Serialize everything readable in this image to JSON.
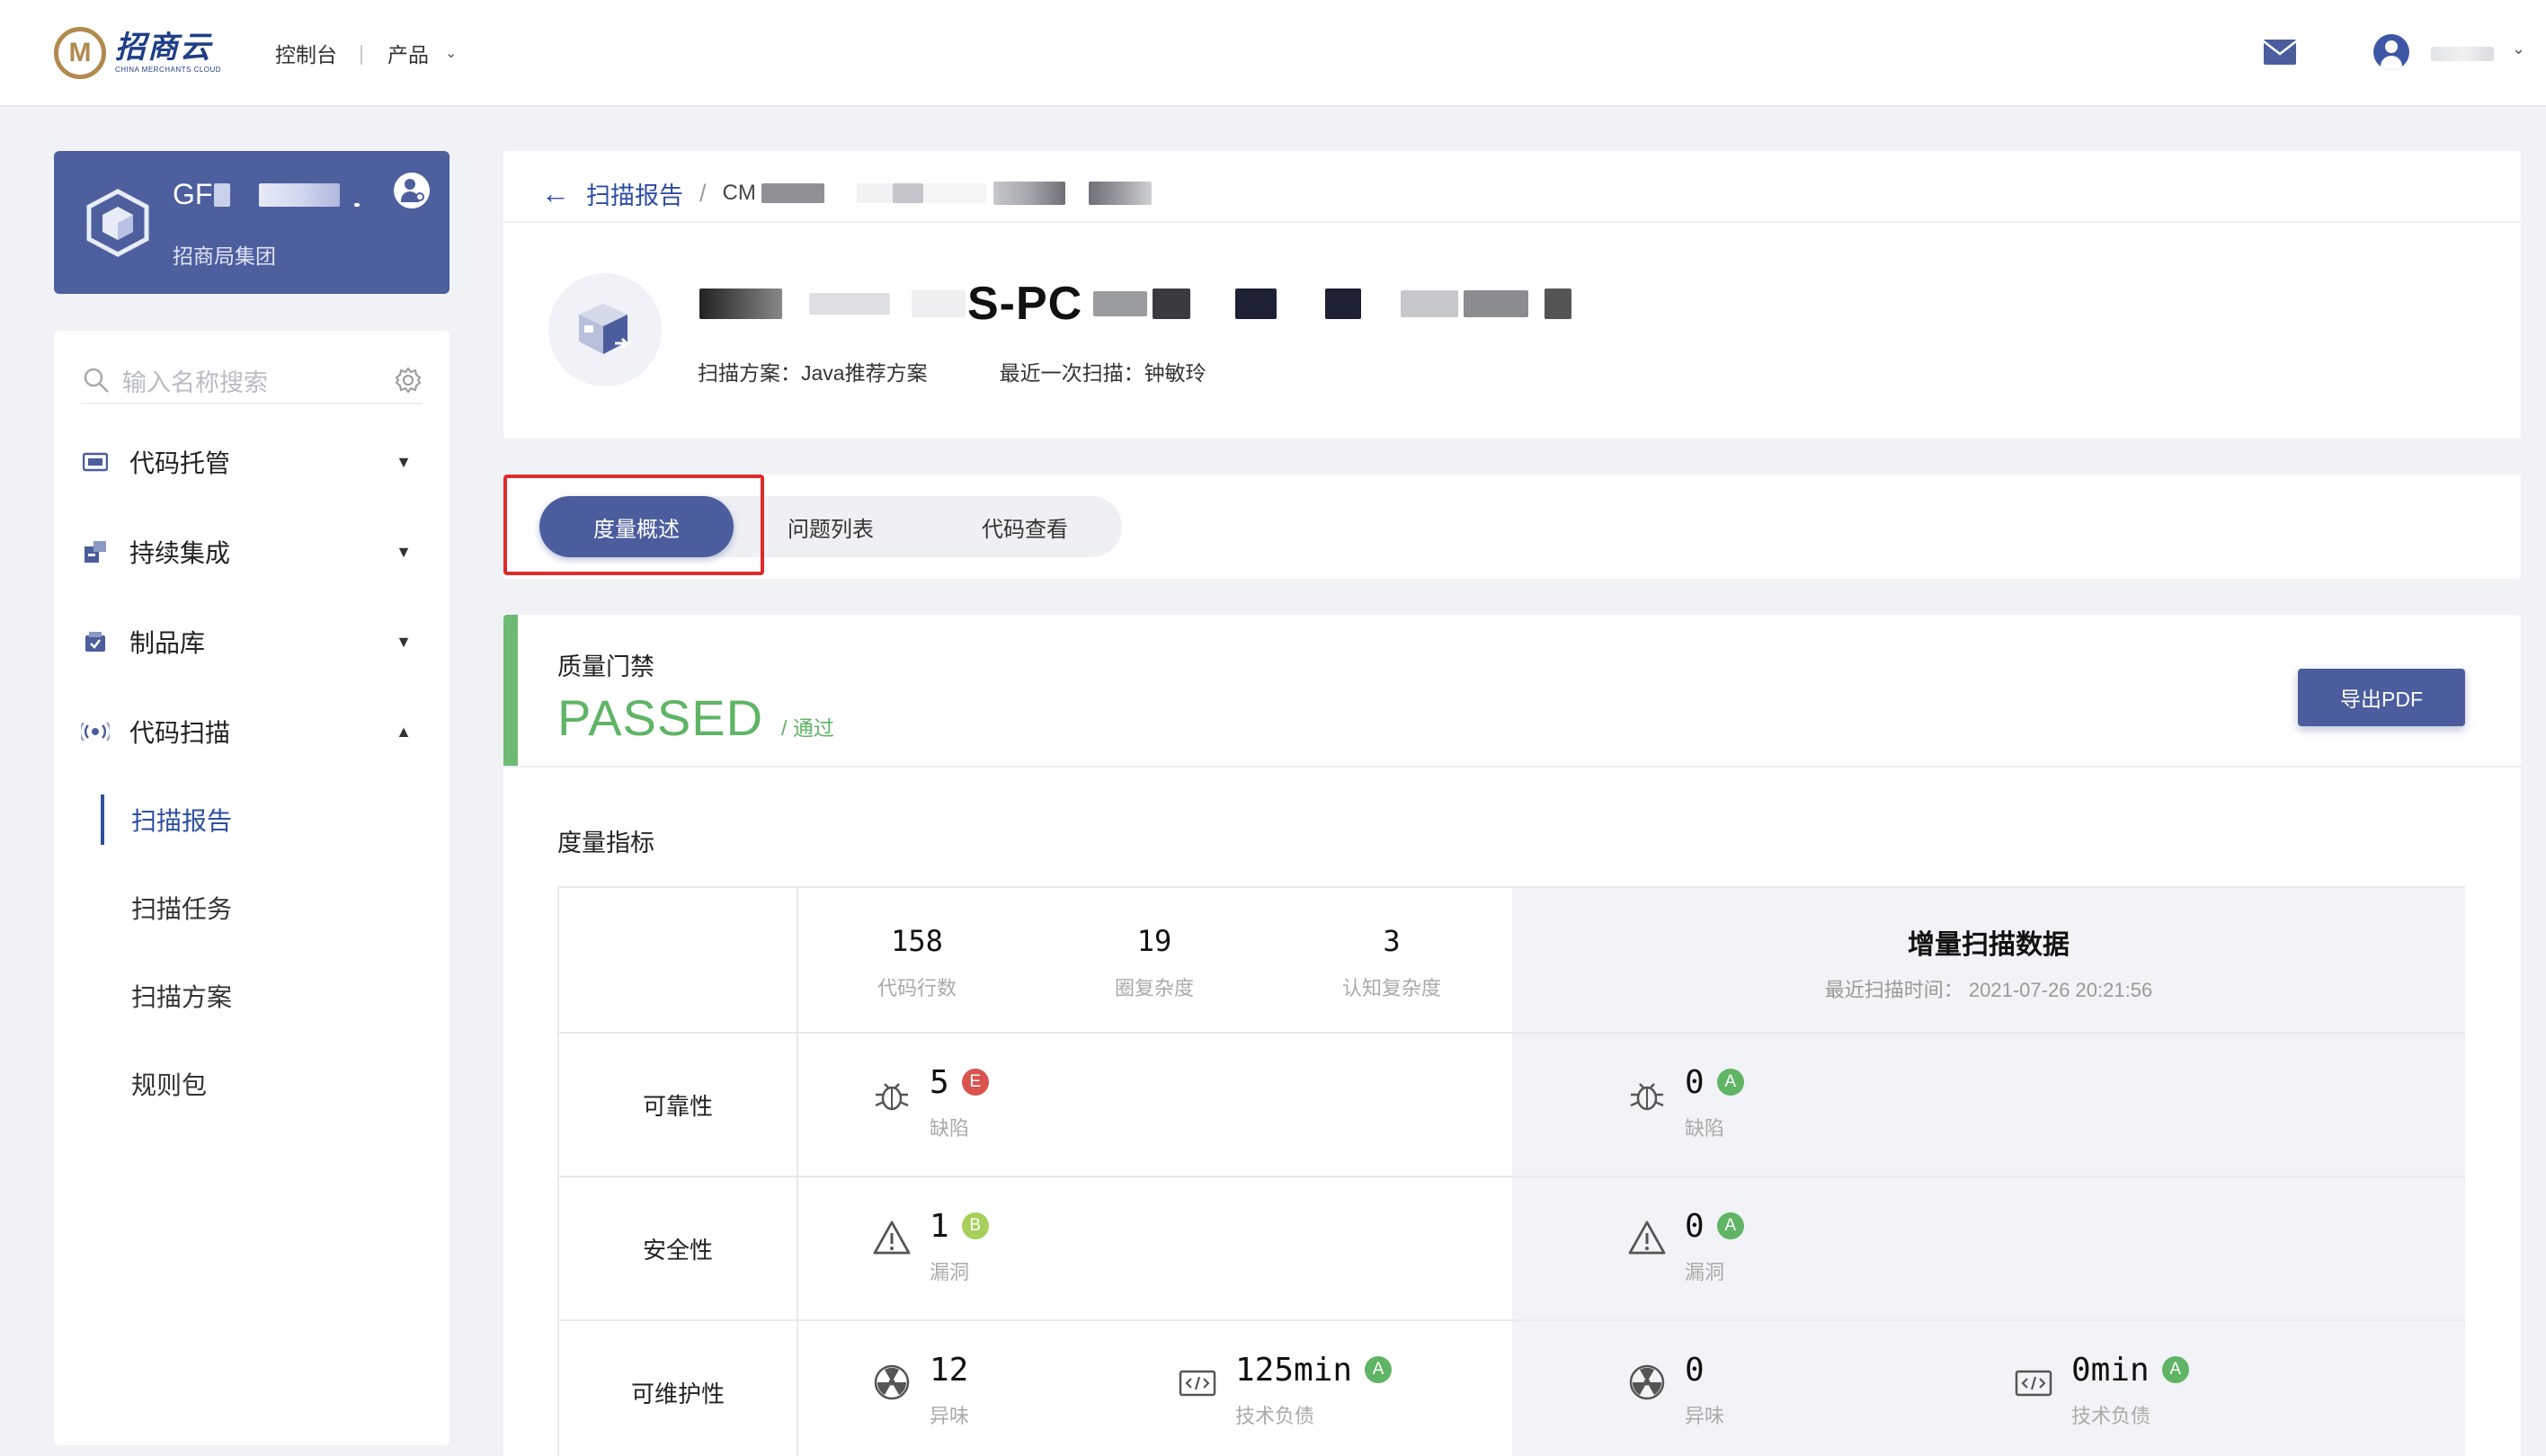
{
  "topbar": {
    "logo_cn": "招商云",
    "logo_en": "CHINA MERCHANTS CLOUD",
    "nav_console": "控制台",
    "nav_separator": "|",
    "nav_products": "产品"
  },
  "org": {
    "name_visible": "GF",
    "subtitle": "招商局集团"
  },
  "sidebar": {
    "search_placeholder": "输入名称搜索",
    "items": [
      {
        "label": "代码托管",
        "expanded": false,
        "icon": "code-repo-icon"
      },
      {
        "label": "持续集成",
        "expanded": false,
        "icon": "ci-icon"
      },
      {
        "label": "制品库",
        "expanded": false,
        "icon": "artifact-icon"
      },
      {
        "label": "代码扫描",
        "expanded": true,
        "icon": "scan-icon"
      }
    ],
    "sub_items": [
      {
        "label": "扫描报告",
        "active": true
      },
      {
        "label": "扫描任务",
        "active": false
      },
      {
        "label": "扫描方案",
        "active": false
      },
      {
        "label": "规则包",
        "active": false
      }
    ]
  },
  "header": {
    "breadcrumb_link": "扫描报告",
    "breadcrumb_sep": "/",
    "breadcrumb_current_visible": "CM",
    "project_title_visible": "S-PC",
    "scan_plan_label": "扫描方案：",
    "scan_plan_value": "Java推荐方案",
    "last_scan_label": "最近一次扫描：",
    "last_scan_value": "钟敏玲"
  },
  "tabs": [
    {
      "label": "度量概述",
      "active": true
    },
    {
      "label": "问题列表",
      "active": false
    },
    {
      "label": "代码查看",
      "active": false
    }
  ],
  "gate": {
    "title": "质量门禁",
    "status": "PASSED",
    "status_cn": "/ 通过",
    "export_label": "导出PDF"
  },
  "metrics": {
    "title": "度量指标",
    "summary": [
      {
        "value": "158",
        "label": "代码行数"
      },
      {
        "value": "19",
        "label": "圈复杂度"
      },
      {
        "value": "3",
        "label": "认知复杂度"
      }
    ],
    "incremental_title": "增量扫描数据",
    "incremental_time": "最近扫描时间：  2021-07-26 20:21:56",
    "rows": [
      {
        "label": "可靠性",
        "full": [
          {
            "icon": "bug-icon",
            "value": "5",
            "grade": "E",
            "label": "缺陷"
          }
        ],
        "incremental": [
          {
            "icon": "bug-icon",
            "value": "0",
            "grade": "A",
            "label": "缺陷"
          }
        ]
      },
      {
        "label": "安全性",
        "full": [
          {
            "icon": "warning-icon",
            "value": "1",
            "grade": "B",
            "label": "漏洞"
          }
        ],
        "incremental": [
          {
            "icon": "warning-icon",
            "value": "0",
            "grade": "A",
            "label": "漏洞"
          }
        ]
      },
      {
        "label": "可维护性",
        "full": [
          {
            "icon": "radiation-icon",
            "value": "12",
            "grade": "",
            "label": "异味"
          },
          {
            "icon": "code-debt-icon",
            "value": "125min",
            "grade": "A",
            "label": "技术负债"
          }
        ],
        "incremental": [
          {
            "icon": "radiation-icon",
            "value": "0",
            "grade": "",
            "label": "异味"
          },
          {
            "icon": "code-debt-icon",
            "value": "0min",
            "grade": "A",
            "label": "技术负债"
          }
        ]
      }
    ]
  },
  "colors": {
    "primary": "#4b5d9c",
    "link": "#2e4ea0",
    "passed": "#5fb465",
    "grade_A": "#5fb465",
    "grade_B": "#a8cf5a",
    "grade_E": "#d9534f",
    "highlight": "#e02b2b"
  }
}
